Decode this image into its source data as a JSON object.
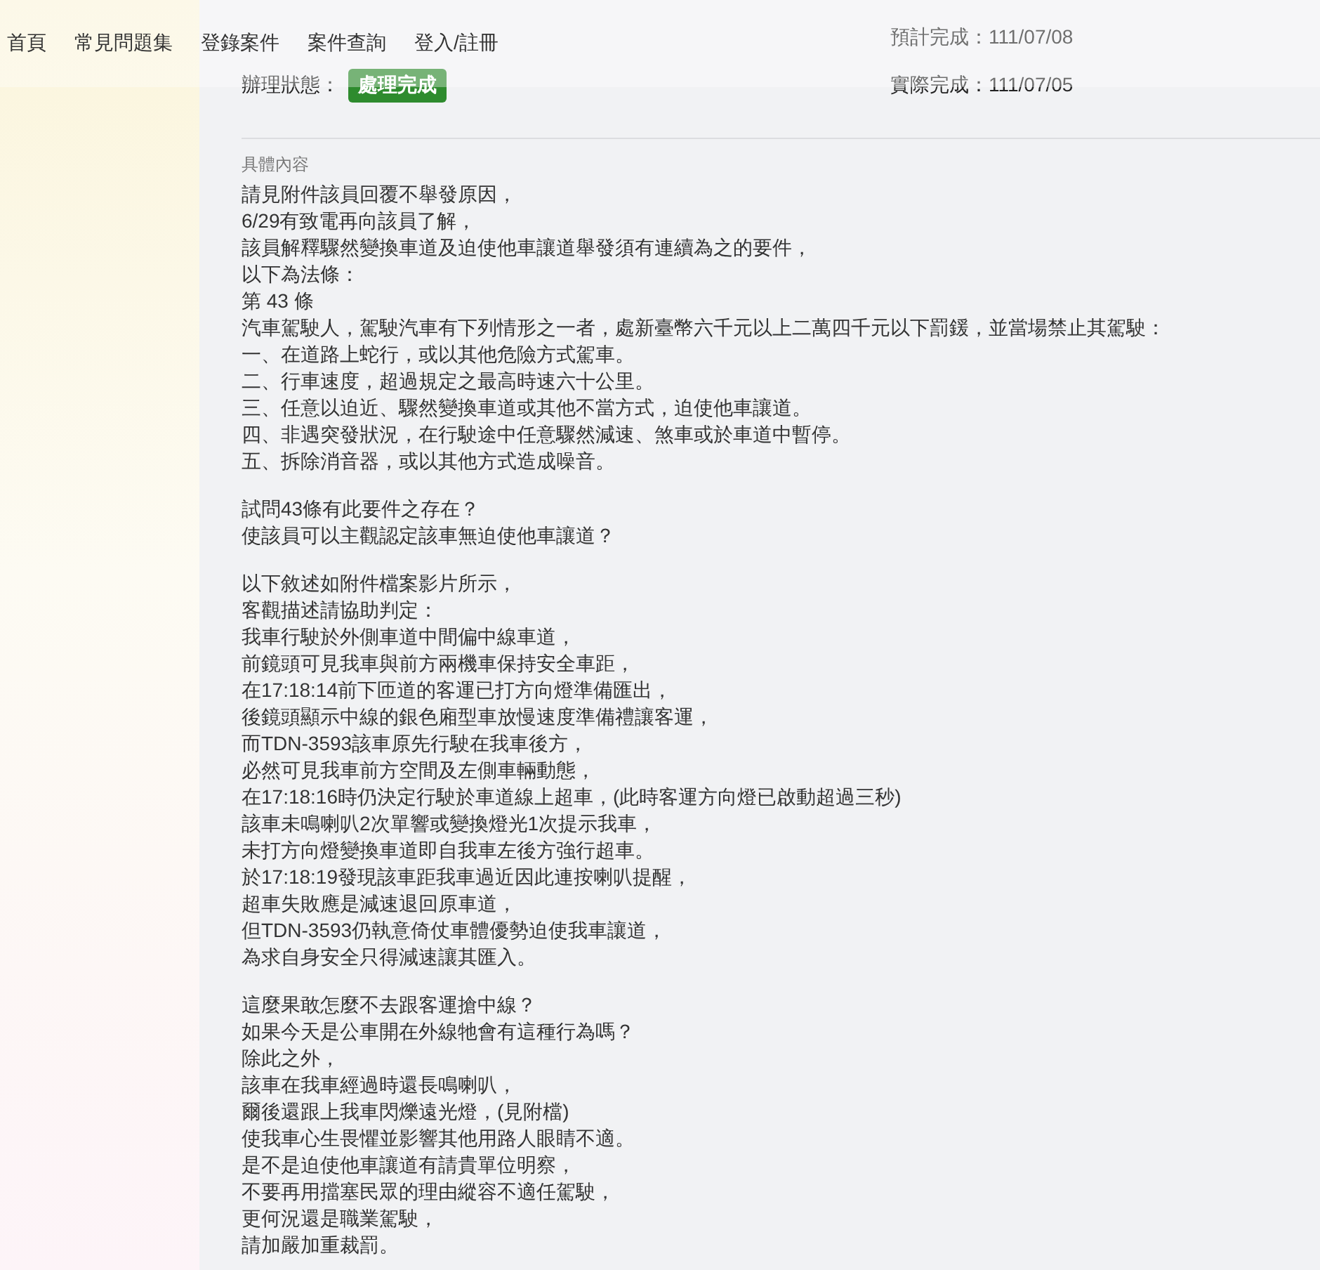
{
  "nav": {
    "brand": "首頁",
    "items": [
      "常見問題集",
      "登錄案件",
      "案件查詢",
      "登入/註冊"
    ]
  },
  "case_info": {
    "expected_completion": "預計完成：111/07/08",
    "status_label": "辦理狀態：",
    "status_badge": "處理完成",
    "actual_completion": "實際完成：111/07/05"
  },
  "content": {
    "label": "具體內容",
    "paragraphs": [
      [
        "請見附件該員回覆不舉發原因，",
        "6/29有致電再向該員了解，",
        "該員解釋驟然變換車道及迫使他車讓道舉發須有連續為之的要件，",
        "以下為法條：",
        "第 43 條",
        "汽車駕駛人，駕駛汽車有下列情形之一者，處新臺幣六千元以上二萬四千元以下罰鍰，並當場禁止其駕駛：",
        "一、在道路上蛇行，或以其他危險方式駕車。",
        "二、行車速度，超過規定之最高時速六十公里。",
        "三、任意以迫近、驟然變換車道或其他不當方式，迫使他車讓道。",
        "四、非遇突發狀況，在行駛途中任意驟然減速、煞車或於車道中暫停。",
        "五、拆除消音器，或以其他方式造成噪音。"
      ],
      [
        "試問43條有此要件之存在？",
        "使該員可以主觀認定該車無迫使他車讓道？"
      ],
      [
        "以下敘述如附件檔案影片所示，",
        "客觀描述請協助判定：",
        "我車行駛於外側車道中間偏中線車道，",
        "前鏡頭可見我車與前方兩機車保持安全車距，",
        "在17:18:14前下匝道的客運已打方向燈準備匯出，",
        "後鏡頭顯示中線的銀色廂型車放慢速度準備禮讓客運，",
        "而TDN-3593該車原先行駛在我車後方，",
        "必然可見我車前方空間及左側車輛動態，",
        "在17:18:16時仍決定行駛於車道線上超車，(此時客運方向燈已啟動超過三秒)",
        "該車未鳴喇叭2次單響或變換燈光1次提示我車，",
        "未打方向燈變換車道即自我車左後方強行超車。",
        "於17:18:19發現該車距我車過近因此連按喇叭提醒，",
        "超車失敗應是減速退回原車道，",
        "但TDN-3593仍執意倚仗車體優勢迫使我車讓道，",
        "為求自身安全只得減速讓其匯入。"
      ],
      [
        "這麼果敢怎麼不去跟客運搶中線？",
        "如果今天是公車開在外線牠會有這種行為嗎？",
        "除此之外，",
        "該車在我車經過時還長鳴喇叭，",
        "爾後還跟上我車閃爍遠光燈，(見附檔)",
        "使我車心生畏懼並影響其他用路人眼睛不適。",
        "是不是迫使他車讓道有請貴單位明察，",
        "不要再用擋塞民眾的理由縱容不適任駕駛，",
        "更何況還是職業駕駛，",
        "請加嚴加重裁罰。"
      ]
    ]
  }
}
